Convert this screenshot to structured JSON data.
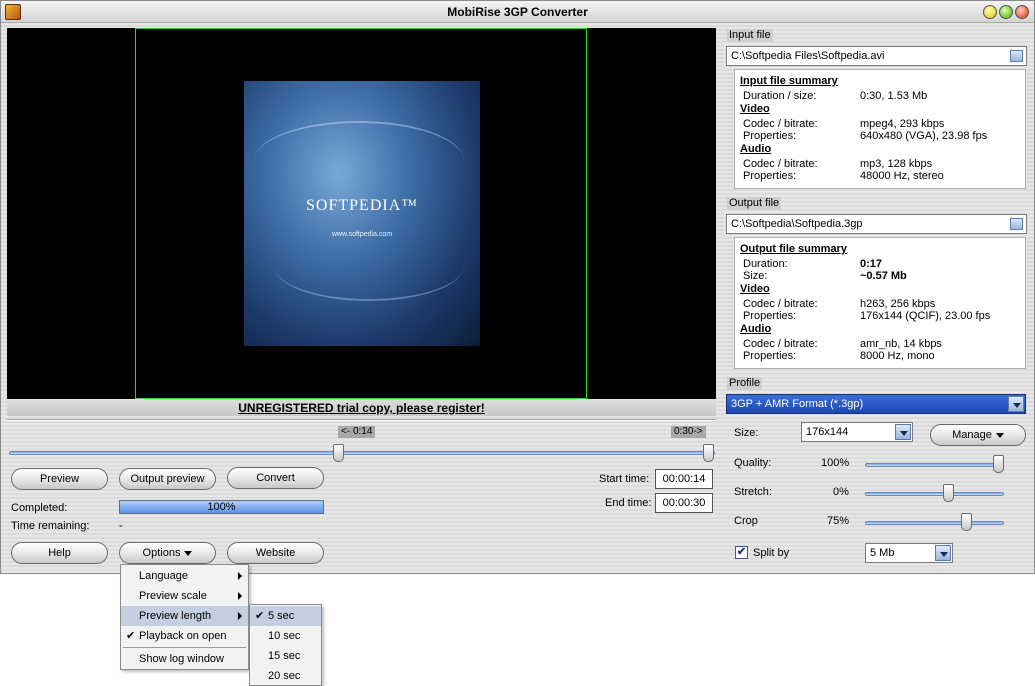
{
  "window": {
    "title": "MobiRise 3GP Converter"
  },
  "preview": {
    "logo_text": "SOFTPEDIA™",
    "url_text": "www.softpedia.com"
  },
  "banner": {
    "text": "UNREGISTERED trial copy, please register!"
  },
  "timeline": {
    "start_tag": "<- 0:14",
    "end_tag": "0:30->"
  },
  "buttons": {
    "preview": "Preview",
    "output_preview": "Output preview",
    "convert": "Convert",
    "help": "Help",
    "options": "Options",
    "website": "Website",
    "manage": "Manage"
  },
  "progress": {
    "completed_label": "Completed:",
    "completed_value": "100%",
    "completed_fraction": 1.0,
    "remaining_label": "Time remaining:",
    "remaining_value": "-"
  },
  "times": {
    "start_label": "Start time:",
    "start_value": "00:00:14",
    "end_label": "End time:",
    "end_value": "00:00:30"
  },
  "input_file": {
    "section_label": "Input file",
    "path": "C:\\Softpedia Files\\Softpedia.avi",
    "summary_title": "Input file summary",
    "duration_label": "Duration / size:",
    "duration_value": "0:30, 1.53 Mb",
    "video_head": "Video",
    "video_codec_label": "Codec / bitrate:",
    "video_codec_value": "mpeg4, 293 kbps",
    "video_props_label": "Properties:",
    "video_props_value": "640x480 (VGA), 23.98 fps",
    "audio_head": "Audio",
    "audio_codec_label": "Codec / bitrate:",
    "audio_codec_value": "mp3, 128 kbps",
    "audio_props_label": "Properties:",
    "audio_props_value": "48000 Hz, stereo"
  },
  "output_file": {
    "section_label": "Output file",
    "path": "C:\\Softpedia\\Softpedia.3gp",
    "summary_title": "Output file summary",
    "duration_label": "Duration:",
    "duration_value": "0:17",
    "size_label": "Size:",
    "size_value": "~0.57 Mb",
    "video_head": "Video",
    "video_codec_label": "Codec / bitrate:",
    "video_codec_value": "h263, 256 kbps",
    "video_props_label": "Properties:",
    "video_props_value": "176x144 (QCIF), 23.00 fps",
    "audio_head": "Audio",
    "audio_codec_label": "Codec / bitrate:",
    "audio_codec_value": "amr_nb, 14 kbps",
    "audio_props_label": "Properties:",
    "audio_props_value": "8000 Hz, mono"
  },
  "profile": {
    "section_label": "Profile",
    "selected": "3GP + AMR Format (*.3gp)"
  },
  "settings": {
    "size_label": "Size:",
    "size_value": "176x144",
    "quality_label": "Quality:",
    "quality_value": "100%",
    "stretch_label": "Stretch:",
    "stretch_value": "0%",
    "crop_label": "Crop",
    "crop_value": "75%",
    "split_label": "Split by",
    "split_checked": true,
    "split_value": "5 Mb"
  },
  "options_menu": {
    "items": [
      {
        "label": "Language",
        "submenu": true,
        "checked": false
      },
      {
        "label": "Preview scale",
        "submenu": true,
        "checked": false
      },
      {
        "label": "Preview length",
        "submenu": true,
        "checked": false,
        "highlighted": true
      },
      {
        "label": "Playback on open",
        "submenu": false,
        "checked": true
      },
      {
        "label": "Show log window",
        "submenu": false,
        "checked": false
      }
    ]
  },
  "preview_length_menu": {
    "items": [
      {
        "label": "5 sec",
        "checked": true,
        "highlighted": true
      },
      {
        "label": "10 sec",
        "checked": false
      },
      {
        "label": "15 sec",
        "checked": false
      },
      {
        "label": "20 sec",
        "checked": false
      }
    ]
  },
  "icons": {
    "app": "app-icon",
    "minimize": "minimize-icon",
    "maximize": "maximize-icon",
    "close": "close-icon",
    "browse": "browse-icon",
    "dropdown": "chevron-down-icon",
    "submenu": "chevron-right-icon",
    "check": "check-icon"
  },
  "colors": {
    "video_frame_border": "#2fcf2f",
    "profile_selected_bg": "#1d46b0",
    "menu_highlight": "#c4d0e2",
    "track_blue": "#7ea8e0"
  }
}
